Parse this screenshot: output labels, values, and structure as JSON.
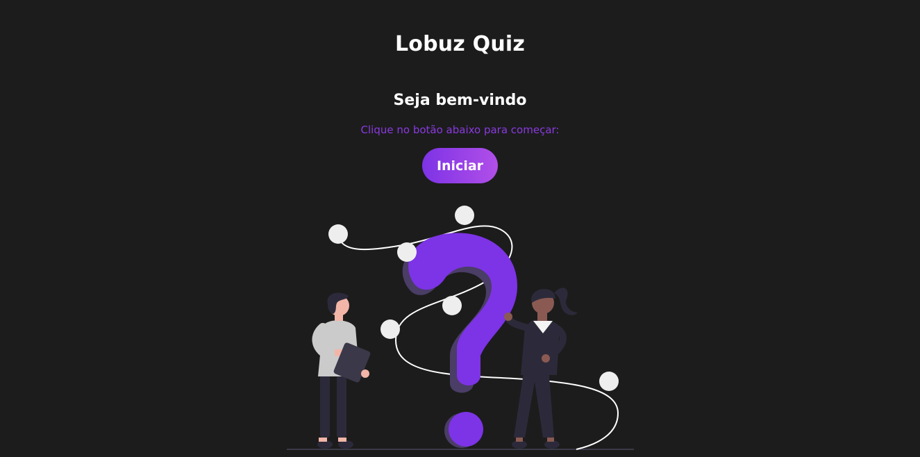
{
  "header": {
    "title": "Lobuz Quiz"
  },
  "welcome": {
    "heading": "Seja bem-vindo",
    "instruction": "Clique no botão abaixo para começar:",
    "start_label": "Iniciar"
  },
  "theme": {
    "background": "#1c1c1c",
    "accent": "#7d33e6",
    "accent_light": "#b14fe8",
    "instruction_color": "#8a3ae0",
    "text": "#ffffff"
  },
  "illustration": {
    "subject": "question-mark-with-two-people"
  }
}
